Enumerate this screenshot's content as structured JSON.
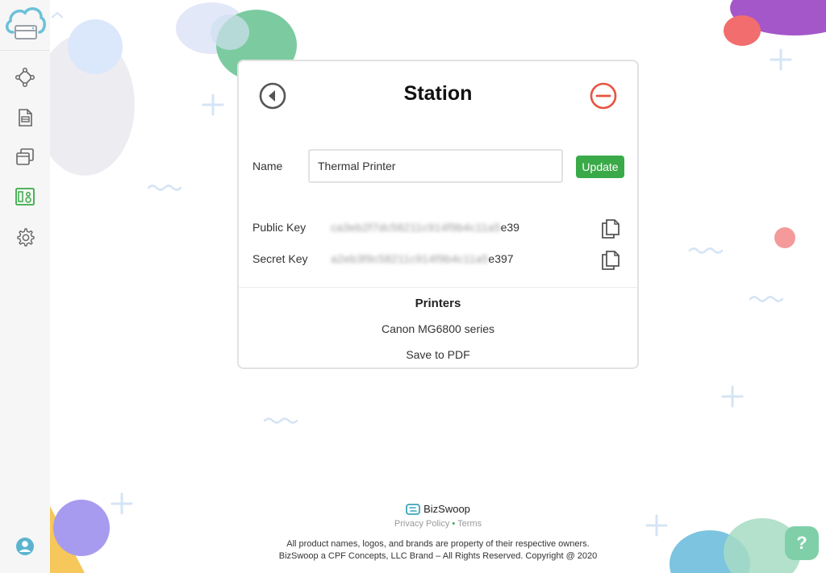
{
  "card": {
    "title": "Station",
    "name_label": "Name",
    "name_value": "Thermal Printer",
    "update_label": "Update",
    "public_key_label": "Public Key",
    "public_key_hidden": "ca3eb2f7dc58211c914f9b4c11a5",
    "public_key_suffix": "e39",
    "secret_key_label": "Secret Key",
    "secret_key_hidden": "a2eb3f9c58211c914f9b4c11a5",
    "secret_key_suffix": "e397",
    "printers_heading": "Printers",
    "printers": [
      "Canon MG6800 series",
      "Save to PDF"
    ]
  },
  "footer": {
    "brand": "BizSwoop",
    "privacy": "Privacy Policy",
    "separator": "•",
    "terms": "Terms",
    "legal_line1": "All product names, logos, and brands are property of their respective owners.",
    "legal_line2": "BizSwoop a CPF Concepts, LLC Brand – All Rights Reserved. Copyright @ 2020"
  },
  "help": {
    "label": "?"
  },
  "colors": {
    "accent_green": "#3aaa48",
    "remove_red": "#e8533f",
    "sidebar_bg": "#f6f6f6"
  }
}
